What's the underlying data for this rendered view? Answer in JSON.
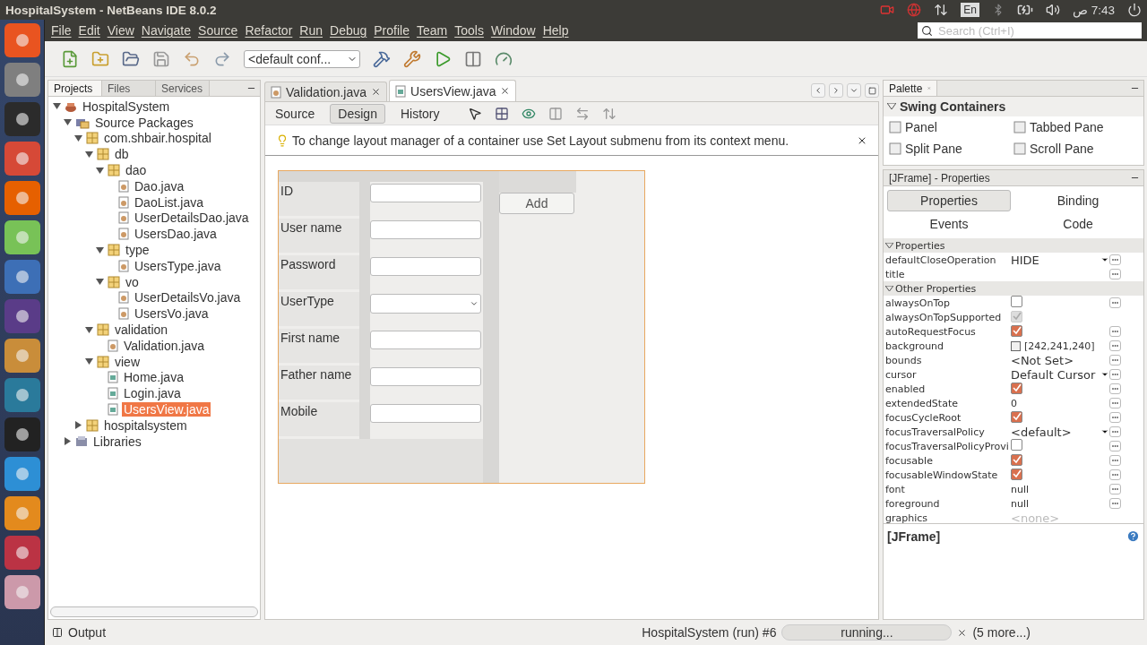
{
  "window": {
    "title": "HospitalSystem - NetBeans IDE 8.0.2"
  },
  "tray": {
    "language": "En",
    "time": "7:43 ص"
  },
  "menu": [
    "File",
    "Edit",
    "View",
    "Navigate",
    "Source",
    "Refactor",
    "Run",
    "Debug",
    "Profile",
    "Team",
    "Tools",
    "Window",
    "Help"
  ],
  "search": {
    "placeholder": "Search (Ctrl+I)"
  },
  "toolbar": {
    "config": "<default conf..."
  },
  "projects": {
    "tabs": [
      {
        "label": "Projects",
        "selected": true
      },
      {
        "label": "Files",
        "selected": false
      },
      {
        "label": "Services",
        "selected": false
      }
    ],
    "tree": [
      {
        "label": "HospitalSystem",
        "kind": "project",
        "expanded": true,
        "selected": false,
        "children": [
          {
            "label": "Source Packages",
            "kind": "sources",
            "expanded": true,
            "selected": false,
            "children": [
              {
                "label": "com.shbair.hospital",
                "kind": "package",
                "expanded": true,
                "selected": false,
                "children": [
                  {
                    "label": "db",
                    "kind": "package",
                    "expanded": true,
                    "selected": false,
                    "children": [
                      {
                        "label": "dao",
                        "kind": "package",
                        "expanded": true,
                        "selected": false,
                        "children": [
                          {
                            "label": "Dao.java",
                            "kind": "java",
                            "selected": false
                          },
                          {
                            "label": "DaoList.java",
                            "kind": "java",
                            "selected": false
                          },
                          {
                            "label": "UserDetailsDao.java",
                            "kind": "java",
                            "selected": false
                          },
                          {
                            "label": "UsersDao.java",
                            "kind": "java",
                            "selected": false
                          }
                        ]
                      },
                      {
                        "label": "type",
                        "kind": "package",
                        "expanded": true,
                        "selected": false,
                        "children": [
                          {
                            "label": "UsersType.java",
                            "kind": "java",
                            "selected": false
                          }
                        ]
                      },
                      {
                        "label": "vo",
                        "kind": "package",
                        "expanded": true,
                        "selected": false,
                        "children": [
                          {
                            "label": "UserDetailsVo.java",
                            "kind": "java",
                            "selected": false
                          },
                          {
                            "label": "UsersVo.java",
                            "kind": "java",
                            "selected": false
                          }
                        ]
                      }
                    ]
                  },
                  {
                    "label": "validation",
                    "kind": "package",
                    "expanded": true,
                    "selected": false,
                    "children": [
                      {
                        "label": "Validation.java",
                        "kind": "java",
                        "selected": false
                      }
                    ]
                  },
                  {
                    "label": "view",
                    "kind": "package",
                    "expanded": true,
                    "selected": false,
                    "children": [
                      {
                        "label": "Home.java",
                        "kind": "form",
                        "selected": false
                      },
                      {
                        "label": "Login.java",
                        "kind": "form",
                        "selected": false
                      },
                      {
                        "label": "UsersView.java",
                        "kind": "form",
                        "selected": true
                      }
                    ]
                  }
                ]
              },
              {
                "label": "hospitalsystem",
                "kind": "package",
                "expanded": false,
                "selected": false
              }
            ]
          },
          {
            "label": "Libraries",
            "kind": "library",
            "expanded": false,
            "selected": false
          }
        ]
      }
    ]
  },
  "editor": {
    "tabs": [
      {
        "label": "Validation.java",
        "selected": false
      },
      {
        "label": "UsersView.java",
        "selected": true
      }
    ],
    "views": [
      {
        "label": "Source",
        "selected": false
      },
      {
        "label": "Design",
        "selected": true
      },
      {
        "label": "History",
        "selected": false
      }
    ],
    "hint": "To change layout manager of a container use Set Layout submenu from its context menu.",
    "form": {
      "fields": [
        {
          "label": "ID",
          "kind": "text"
        },
        {
          "label": "User name",
          "kind": "text"
        },
        {
          "label": "Password",
          "kind": "text"
        },
        {
          "label": "UserType",
          "kind": "combo"
        },
        {
          "label": "First name",
          "kind": "text"
        },
        {
          "label": "Father name",
          "kind": "text"
        },
        {
          "label": "Mobile",
          "kind": "text"
        }
      ],
      "button": "Add"
    }
  },
  "palette": {
    "title": "Palette",
    "category": "Swing Containers",
    "items": [
      "Panel",
      "Tabbed Pane",
      "Split Pane",
      "Scroll Pane"
    ]
  },
  "properties": {
    "title": "[JFrame] - Properties",
    "tabs": [
      {
        "label": "Properties",
        "selected": true
      },
      {
        "label": "Binding",
        "selected": false
      },
      {
        "label": "Events",
        "selected": false
      },
      {
        "label": "Code",
        "selected": false
      }
    ],
    "groups": [
      {
        "name": "Properties",
        "rows": [
          {
            "name": "defaultCloseOperation",
            "kind": "combo",
            "value": "HIDE"
          },
          {
            "name": "title",
            "kind": "text"
          }
        ]
      },
      {
        "name": "Other Properties",
        "rows": [
          {
            "name": "alwaysOnTop",
            "kind": "check",
            "checked": false
          },
          {
            "name": "alwaysOnTopSupported",
            "kind": "check",
            "checked": true,
            "disabled": true
          },
          {
            "name": "autoRequestFocus",
            "kind": "check",
            "checked": true
          },
          {
            "name": "background",
            "kind": "color",
            "value": "[242,241,240]"
          },
          {
            "name": "bounds",
            "kind": "large",
            "value": "<Not Set>"
          },
          {
            "name": "cursor",
            "kind": "combo",
            "value": "Default Cursor"
          },
          {
            "name": "enabled",
            "kind": "check",
            "checked": true
          },
          {
            "name": "extendedState",
            "kind": "text",
            "value": "0"
          },
          {
            "name": "focusCycleRoot",
            "kind": "check",
            "checked": true
          },
          {
            "name": "focusTraversalPolicy",
            "kind": "combo",
            "value": "<default>"
          },
          {
            "name": "focusTraversalPolicyProvi",
            "kind": "check",
            "checked": false
          },
          {
            "name": "focusable",
            "kind": "check",
            "checked": true
          },
          {
            "name": "focusableWindowState",
            "kind": "check",
            "checked": true
          },
          {
            "name": "font",
            "kind": "text",
            "value": "null"
          },
          {
            "name": "foreground",
            "kind": "text",
            "value": "null"
          },
          {
            "name": "graphics",
            "kind": "disabled",
            "value": "<none>"
          }
        ]
      }
    ],
    "description": "[JFrame]"
  },
  "status": {
    "output": "Output",
    "task": "HospitalSystem (run) #6",
    "progress": "running...",
    "more": "(5 more...)"
  }
}
